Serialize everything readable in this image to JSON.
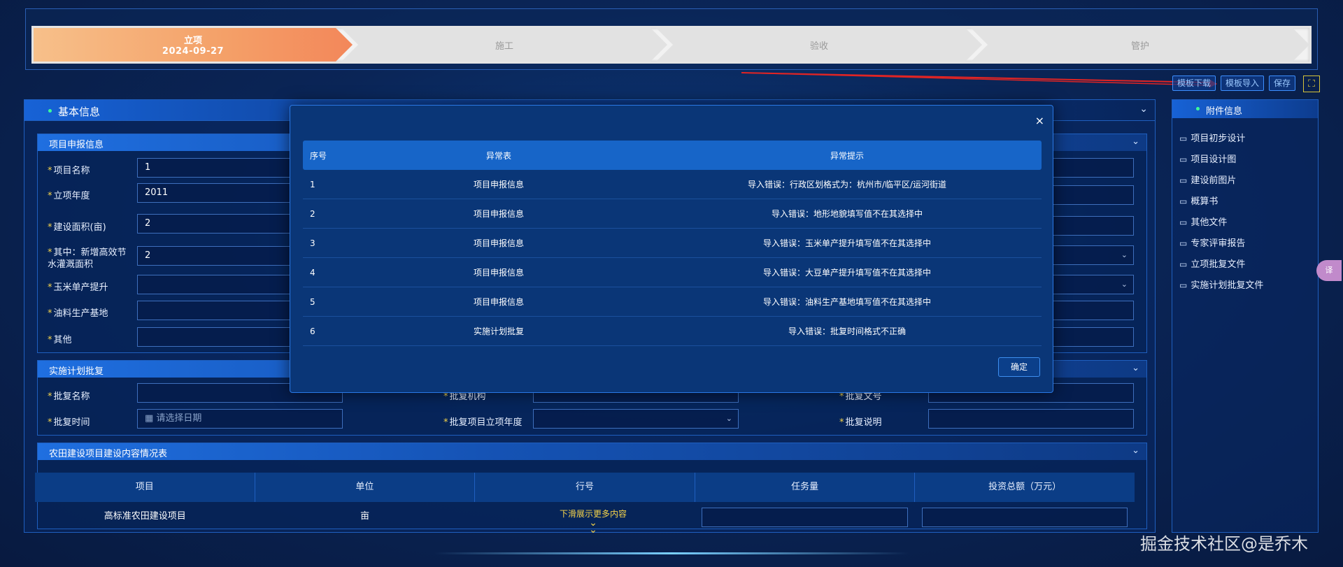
{
  "steps": [
    {
      "label": "立项",
      "date": "2024-09-27"
    },
    {
      "label": "施工"
    },
    {
      "label": "验收"
    },
    {
      "label": "管护"
    }
  ],
  "toolbar": {
    "download_label": "模板下载",
    "import_label": "模板导入",
    "save_label": "保存",
    "fullscreen_icon": "fullscreen-icon"
  },
  "main": {
    "title": "基本信息",
    "sections": {
      "apply": {
        "title": "项目申报信息",
        "fields": [
          {
            "label": "项目名称",
            "value": "1"
          },
          {
            "label": "立项年度",
            "value": "2011"
          },
          {
            "label": "建设面积(亩)",
            "value": "2"
          },
          {
            "label": "其中：新增高效节水灌溉面积",
            "value": "2"
          },
          {
            "label": "玉米单产提升",
            "value": ""
          },
          {
            "label": "油料生产基地",
            "value": ""
          },
          {
            "label": "其他",
            "value": ""
          }
        ]
      },
      "approve": {
        "title": "实施计划批复",
        "fields": [
          {
            "label": "批复名称",
            "value": ""
          },
          {
            "label": "批复机构",
            "value": ""
          },
          {
            "label": "批复文号",
            "value": ""
          },
          {
            "label": "批复时间",
            "placeholder": "请选择日期"
          },
          {
            "label": "批复项目立项年度",
            "value": ""
          },
          {
            "label": "批复说明",
            "value": ""
          }
        ]
      },
      "content": {
        "title": "农田建设项目建设内容情况表",
        "columns": [
          "项目",
          "单位",
          "行号",
          "任务量",
          "投资总额（万元）"
        ],
        "row": {
          "project": "高标准农田建设项目",
          "unit": "亩"
        },
        "scroll_hint": "下滑展示更多内容"
      }
    }
  },
  "side": {
    "title": "附件信息",
    "items": [
      "项目初步设计",
      "项目设计图",
      "建设前图片",
      "概算书",
      "其他文件",
      "专家评审报告",
      "立项批复文件",
      "实施计划批复文件"
    ]
  },
  "modal": {
    "close": "×",
    "columns": [
      "序号",
      "异常表",
      "异常提示"
    ],
    "rows": [
      {
        "no": "1",
        "table": "项目申报信息",
        "tip": "导入错误：行政区划格式为：杭州市/临平区/运河街道"
      },
      {
        "no": "2",
        "table": "项目申报信息",
        "tip": "导入错误：地形地貌填写值不在其选择中"
      },
      {
        "no": "3",
        "table": "项目申报信息",
        "tip": "导入错误：玉米单产提升填写值不在其选择中"
      },
      {
        "no": "4",
        "table": "项目申报信息",
        "tip": "导入错误：大豆单产提升填写值不在其选择中"
      },
      {
        "no": "5",
        "table": "项目申报信息",
        "tip": "导入错误：油料生产基地填写值不在其选择中"
      },
      {
        "no": "6",
        "table": "实施计划批复",
        "tip": "导入错误：批复时间格式不正确"
      }
    ],
    "confirm_label": "确定"
  },
  "watermark": "掘金技术社区@是乔木",
  "float_badge": "译"
}
